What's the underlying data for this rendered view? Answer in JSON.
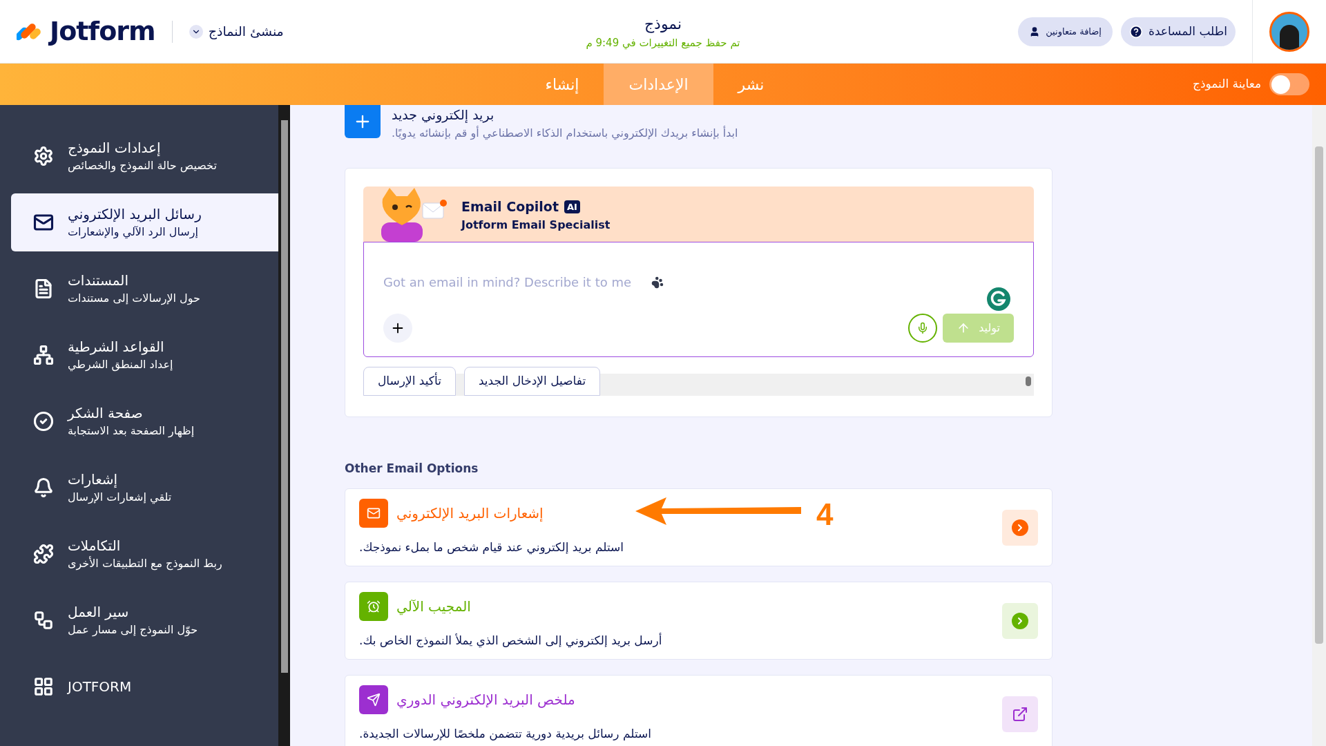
{
  "header": {
    "logo": "Jotform",
    "builder_label": "منشئ النماذج",
    "title": "نموذج",
    "save_status": "تم حفظ جميع التغييرات في 9:49 م",
    "collaborators_button": "إضافة متعاونين",
    "help_button": "اطلب المساعدة"
  },
  "nav": {
    "tabs": [
      {
        "label": "نشر",
        "selected": false
      },
      {
        "label": "الإعدادات",
        "selected": true
      },
      {
        "label": "إنشاء",
        "selected": false
      }
    ],
    "preview": {
      "label": "معاينة النموذج",
      "on": false
    }
  },
  "sidebar": {
    "items": [
      {
        "kind": "gear",
        "title": "إعدادات النموذج",
        "subtitle": "تخصيص حالة النموذج والخصائص",
        "selected": false
      },
      {
        "kind": "mail",
        "title": "رسائل البريد الإلكتروني",
        "subtitle": "إرسال الرد الآلي والإشعارات",
        "selected": true
      },
      {
        "kind": "document",
        "title": "المستندات",
        "subtitle": "حول الإرسالات إلى مستندات",
        "selected": false
      },
      {
        "kind": "hierarchy",
        "title": "القواعد الشرطية",
        "subtitle": "إعداد المنطق الشرطي",
        "selected": false
      },
      {
        "kind": "check",
        "title": "صفحة الشكر",
        "subtitle": "إظهار الصفحة بعد الاستجابة",
        "selected": false
      },
      {
        "kind": "bell",
        "title": "إشعارات",
        "subtitle": "تلقي إشعارات الإرسال",
        "selected": false
      },
      {
        "kind": "puzzle",
        "title": "التكاملات",
        "subtitle": "ربط النموذج مع التطبيقات الأخرى",
        "selected": false
      },
      {
        "kind": "workflow",
        "title": "سير العمل",
        "subtitle": "حوّل النموذج إلى مسار عمل",
        "selected": false
      },
      {
        "kind": "grid",
        "title": "JOTFORM",
        "selected": false
      }
    ]
  },
  "new_email": {
    "title": "بريد إلكتروني جديد",
    "description": "ابدأ بإنشاء بريدك الإلكتروني باستخدام الذكاء الاصطناعي أو قم بإنشائه يدويًا."
  },
  "copilot": {
    "name": "Email Copilot",
    "badge": "AI",
    "subtitle": "Jotform Email Specialist",
    "placeholder": "Got an email in mind? Describe it to me",
    "generate_button": "توليد",
    "suggestions": [
      {
        "label": "تفاصيل الإدخال الجديد"
      },
      {
        "label": "تأكيد الإرسال"
      }
    ]
  },
  "other_options": {
    "heading": "Other Email Options",
    "items": [
      {
        "kind": "arrow",
        "title": "إشعارات البريد الإلكتروني",
        "description": "استلم بريد إلكتروني عند قيام شخص ما بملء نموذجك.",
        "color": "#ff6100"
      },
      {
        "kind": "arrow",
        "title": "المجيب الآلي",
        "description": "أرسل بريد إلكتروني إلى الشخص الذي يملأ النموذج الخاص بك.",
        "color": "#64b200"
      },
      {
        "kind": "external",
        "title": "ملخص البريد الإلكتروني الدوري",
        "description": "استلم رسائل بريدية دورية تتضمن ملخصًا للإرسالات الجديدة.",
        "color": "#9c2fd0"
      }
    ]
  },
  "annotation": {
    "label": "4"
  }
}
